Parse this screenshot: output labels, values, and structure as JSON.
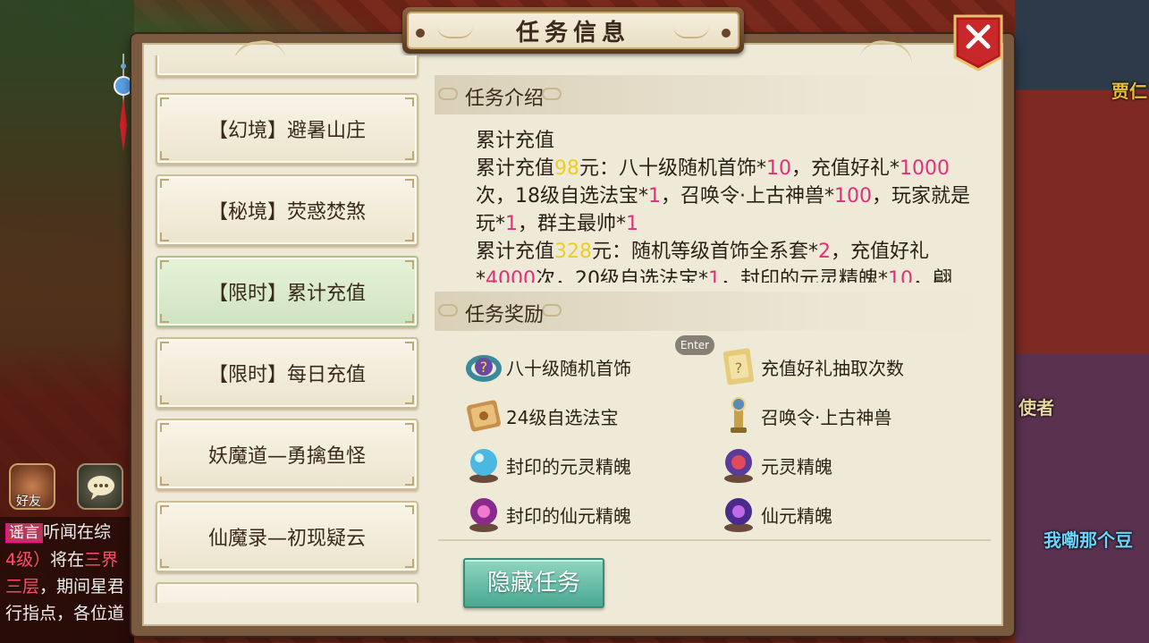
{
  "scene": {
    "npc_jia": "贾仁",
    "npc_shizhe": "使者",
    "npc_dou": "我嘞那个豆",
    "friend_label": "好友",
    "chat_lines": [
      {
        "tag": "谣言",
        "text": "听闻在综"
      },
      {
        "red": "4级）",
        "text": "将在",
        "red2": "三界"
      },
      {
        "red": "三层",
        "text": "，期间星君"
      },
      {
        "text": "行指点，各位道"
      }
    ]
  },
  "dialog": {
    "title": "任务信息",
    "close_icon": "close-x-icon",
    "tasks": [
      {
        "label": ""
      },
      {
        "label": "【幻境】避暑山庄"
      },
      {
        "label": "【秘境】荧惑焚煞"
      },
      {
        "label": "【限时】累计充值",
        "active": true
      },
      {
        "label": "【限时】每日充值"
      },
      {
        "label": "妖魔道—勇擒鱼怪"
      },
      {
        "label": "仙魔录—初现疑云"
      },
      {
        "label": ""
      }
    ],
    "intro": {
      "header": "任务介绍",
      "title": "累计充值",
      "line1": {
        "a": "累计充值",
        "b": "98",
        "c": "元：八十级随机首饰*",
        "d": "10",
        "e": "，充值好礼*",
        "f": "1000",
        "g": "次，18级自选法宝*",
        "h": "1",
        "i": "，召唤令·上古神兽*",
        "j": "100",
        "k": "，玩家就是玩*",
        "l": "1",
        "m": "，群主最帅*",
        "n": "1"
      },
      "line2": {
        "a": "累计充值",
        "b": "328",
        "c": "元：随机等级首饰全系套*",
        "d": "2",
        "e": "，充值好礼*",
        "f": "4000",
        "g": "次，20级自选法宝*",
        "h": "1",
        "i": "，封印的元灵精魄*",
        "j": "10",
        "k": "，翩"
      }
    },
    "reward": {
      "header": "任务奖励",
      "items": [
        {
          "label": "八十级随机首饰",
          "icon": "ring-icon"
        },
        {
          "label": "充值好礼抽取次数",
          "icon": "mystery-card-icon"
        },
        {
          "label": "24级自选法宝",
          "icon": "scroll-icon"
        },
        {
          "label": "召唤令·上古神兽",
          "icon": "summon-token-icon"
        },
        {
          "label": "封印的元灵精魄",
          "icon": "sealed-orb-blue-icon"
        },
        {
          "label": "元灵精魄",
          "icon": "orb-red-icon"
        },
        {
          "label": "封印的仙元精魄",
          "icon": "sealed-orb-purple-icon"
        },
        {
          "label": "仙元精魄",
          "icon": "orb-purple-icon"
        }
      ]
    },
    "enter_hint": "Enter",
    "hide_button": "隐藏任务"
  }
}
